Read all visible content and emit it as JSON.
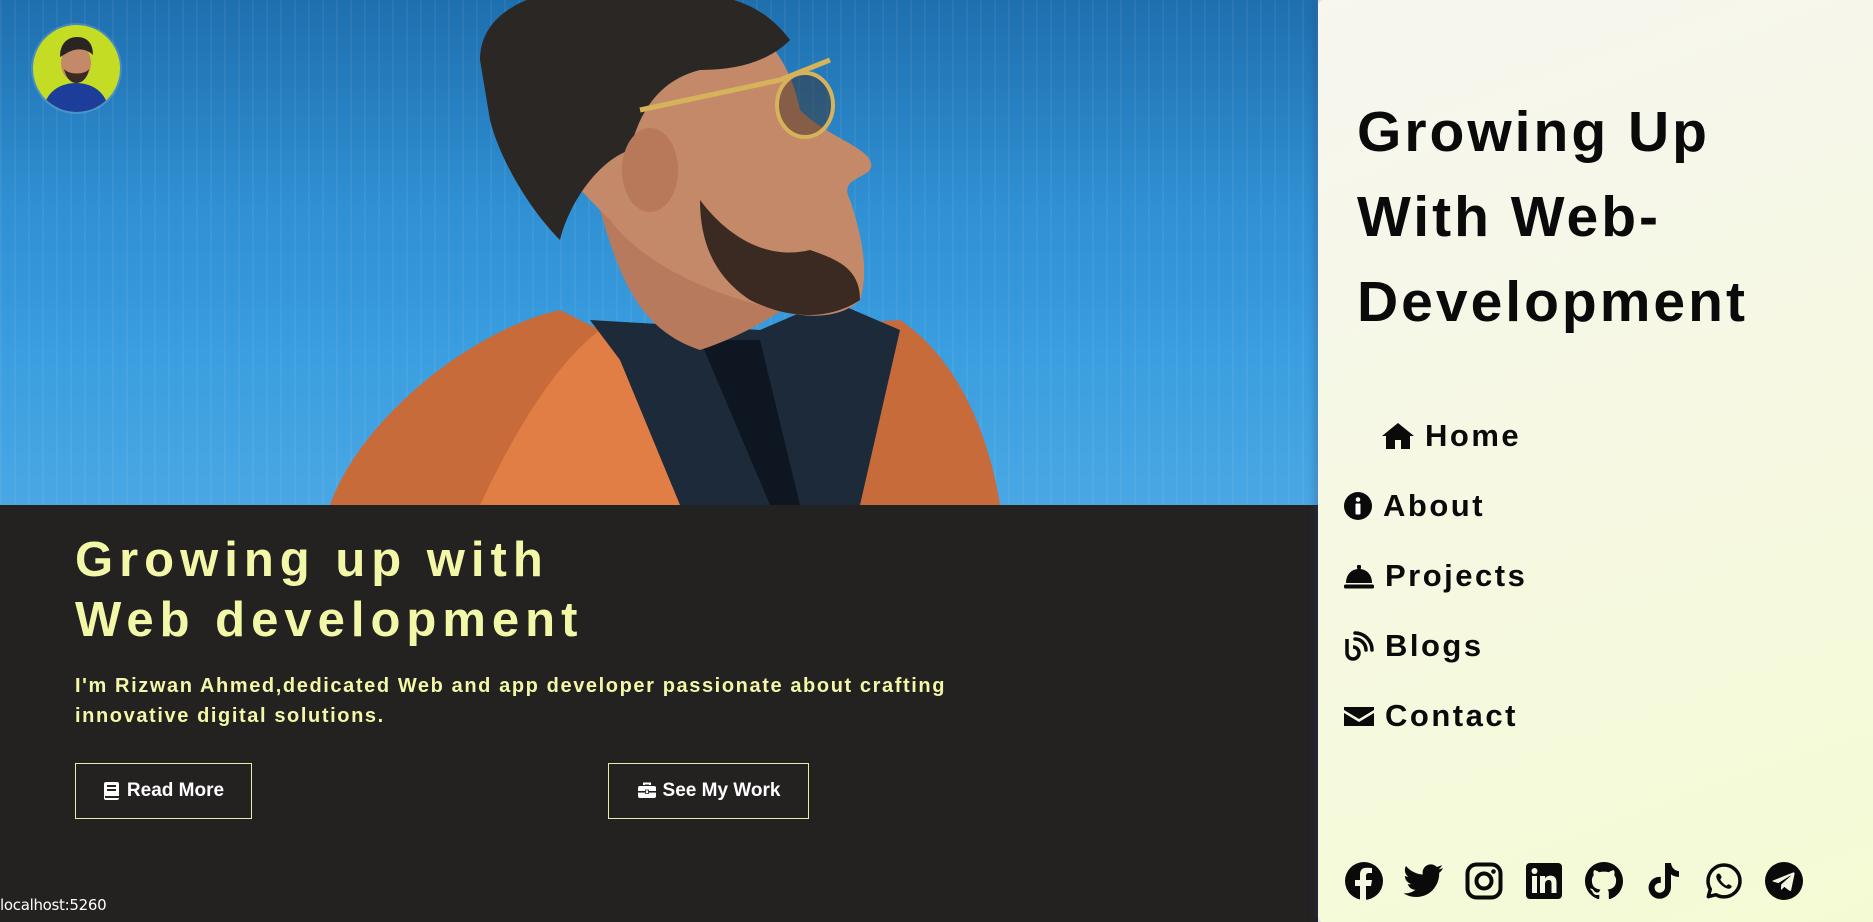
{
  "hero": {
    "title_line1": "Growing up with",
    "title_line2": "Web development",
    "subtitle": "I'm Rizwan Ahmed,dedicated Web and app developer passionate about crafting innovative digital solutions.",
    "read_more_label": "Read More",
    "see_work_label": "See My Work"
  },
  "sidebar": {
    "title_line1": "Growing Up",
    "title_line2": "With Web-",
    "title_line3": "Development",
    "nav": [
      {
        "label": "Home",
        "icon": "home-icon"
      },
      {
        "label": "About",
        "icon": "info-icon"
      },
      {
        "label": "Projects",
        "icon": "bell-icon"
      },
      {
        "label": "Blogs",
        "icon": "blog-icon"
      },
      {
        "label": "Contact",
        "icon": "envelope-icon"
      }
    ],
    "socials": [
      "facebook-icon",
      "twitter-icon",
      "instagram-icon",
      "linkedin-icon",
      "github-icon",
      "tiktok-icon",
      "whatsapp-icon",
      "telegram-icon"
    ]
  },
  "status_bar": {
    "url": "localhost:5260"
  },
  "colors": {
    "accent_text": "#f3f7a8",
    "dark_panel": "#242121",
    "sidebar_bg": "#f6f8e4"
  }
}
